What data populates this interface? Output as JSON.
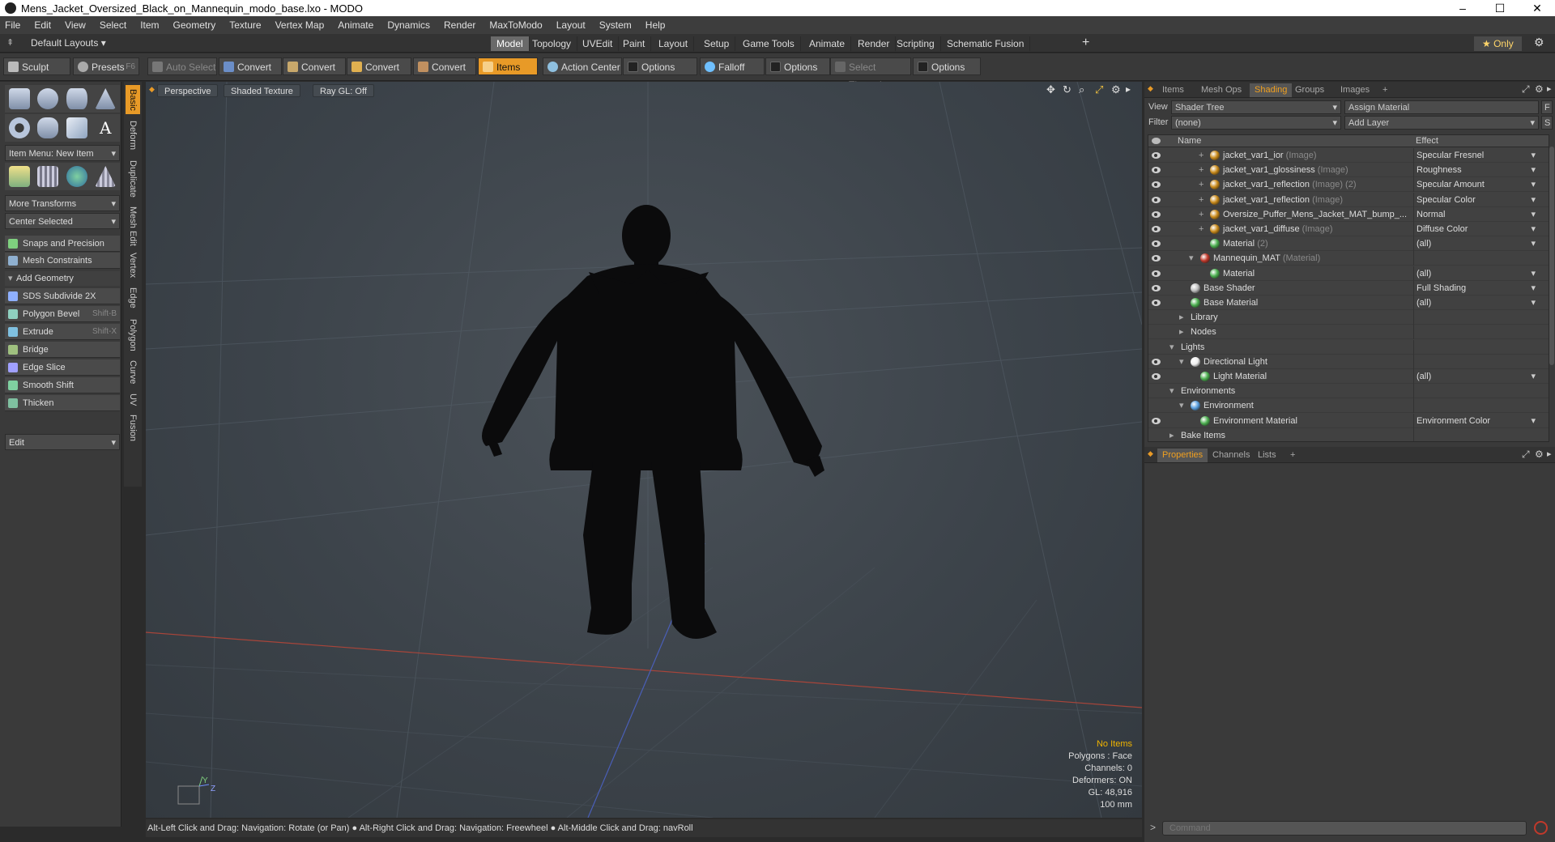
{
  "window": {
    "title": "Mens_Jacket_Oversized_Black_on_Mannequin_modo_base.lxo - MODO",
    "minimize": "–",
    "maximize": "☐",
    "close": "✕"
  },
  "menu": [
    "File",
    "Edit",
    "View",
    "Select",
    "Item",
    "Geometry",
    "Texture",
    "Vertex Map",
    "Animate",
    "Dynamics",
    "Render",
    "MaxToModo",
    "Layout",
    "System",
    "Help"
  ],
  "layout": {
    "preset": "Default Layouts ▾",
    "tabs": [
      "Model",
      "Topology",
      "UVEdit",
      "Paint",
      "Layout",
      "Setup",
      "Game Tools",
      "Animate",
      "Render",
      "Scripting",
      "Schematic Fusion"
    ],
    "active_tab": "Model",
    "add": "+",
    "only": "★  Only"
  },
  "toolbar": {
    "sculpt": "Sculpt",
    "presets": "Presets",
    "presets_key": "F6",
    "auto_select": "Auto Select",
    "convert1": "Convert",
    "convert2": "Convert",
    "convert3": "Convert",
    "convert4": "Convert",
    "items": "Items",
    "action_center": "Action Center",
    "options1": "Options",
    "falloff": "Falloff",
    "options2": "Options",
    "select_through": "Select Through",
    "options3": "Options"
  },
  "left": {
    "item_menu": "Item Menu: New Item",
    "more_transforms": "More Transforms",
    "center_selected": "Center Selected",
    "snaps": "Snaps and Precision",
    "mesh_constraints": "Mesh Constraints",
    "add_geometry": "Add Geometry",
    "tools": [
      {
        "label": "SDS Subdivide 2X",
        "key": ""
      },
      {
        "label": "Polygon Bevel",
        "key": "Shift-B"
      },
      {
        "label": "Extrude",
        "key": "Shift-X"
      },
      {
        "label": "Bridge",
        "key": ""
      },
      {
        "label": "Edge Slice",
        "key": ""
      },
      {
        "label": "Smooth Shift",
        "key": ""
      },
      {
        "label": "Thicken",
        "key": ""
      }
    ],
    "edit": "Edit",
    "vtabs": [
      "Basic",
      "Deform",
      "Duplicate",
      "Mesh Edit",
      "Vertex",
      "Edge",
      "Polygon",
      "Curve",
      "UV",
      "Fusion"
    ]
  },
  "viewport": {
    "perspective": "Perspective",
    "shading": "Shaded Texture",
    "raygl": "Ray GL: Off",
    "info": [
      "No Items",
      "Polygons : Face",
      "Channels: 0",
      "Deformers: ON",
      "GL: 48,916",
      "100 mm"
    ],
    "axis_y": "Y",
    "axis_z": "Z"
  },
  "status": "Alt-Left Click and Drag: Navigation: Rotate (or Pan) ● Alt-Right Click and Drag: Navigation: Freewheel ● Alt-Middle Click and Drag: navRoll",
  "shading": {
    "tabs": [
      "Items",
      "Mesh Ops",
      "Shading",
      "Groups",
      "Images",
      "+"
    ],
    "active_tab": "Shading",
    "view_label": "View",
    "view_value": "Shader Tree",
    "assign": "Assign Material",
    "f_btn": "F",
    "filter_label": "Filter",
    "filter_value": "(none)",
    "add_layer": "Add Layer",
    "s_btn": "S",
    "col_name": "Name",
    "col_effect": "Effect",
    "rows": [
      {
        "name": "jacket_var1_ior",
        "type": "(Image)",
        "effect": "Specular Fresnel",
        "indent": 3,
        "eye": true,
        "plus": true,
        "color": "#c98a1a",
        "drop": true
      },
      {
        "name": "jacket_var1_glossiness",
        "type": "(Image)",
        "effect": "Roughness",
        "indent": 3,
        "eye": true,
        "plus": true,
        "color": "#c98a1a",
        "drop": true
      },
      {
        "name": "jacket_var1_reflection",
        "type": "(Image) (2)",
        "effect": "Specular Amount",
        "indent": 3,
        "eye": true,
        "plus": true,
        "color": "#c98a1a",
        "drop": true
      },
      {
        "name": "jacket_var1_reflection",
        "type": "(Image)",
        "effect": "Specular Color",
        "indent": 3,
        "eye": true,
        "plus": true,
        "color": "#c98a1a",
        "drop": true
      },
      {
        "name": "Oversize_Puffer_Mens_Jacket_MAT_bump_...",
        "type": "",
        "effect": "Normal",
        "indent": 3,
        "eye": true,
        "plus": true,
        "color": "#c98a1a",
        "drop": true
      },
      {
        "name": "jacket_var1_diffuse",
        "type": "(Image)",
        "effect": "Diffuse Color",
        "indent": 3,
        "eye": true,
        "plus": true,
        "color": "#c98a1a",
        "drop": true
      },
      {
        "name": "Material",
        "type": "(2)",
        "effect": "(all)",
        "indent": 3,
        "eye": true,
        "plus": false,
        "color": "#4caf50",
        "drop": true
      },
      {
        "name": "Mannequin_MAT",
        "type": "(Material)",
        "effect": "",
        "indent": 2,
        "eye": true,
        "plus": false,
        "color": "#c0392b",
        "drop": false
      },
      {
        "name": "Material",
        "type": "",
        "effect": "(all)",
        "indent": 3,
        "eye": true,
        "plus": false,
        "color": "#4caf50",
        "drop": true
      },
      {
        "name": "Base Shader",
        "type": "",
        "effect": "Full Shading",
        "indent": 1,
        "eye": true,
        "plus": false,
        "color": "#bdbdbd",
        "drop": true
      },
      {
        "name": "Base Material",
        "type": "",
        "effect": "(all)",
        "indent": 1,
        "eye": true,
        "plus": false,
        "color": "#4caf50",
        "drop": true
      },
      {
        "name": "Library",
        "type": "",
        "effect": "",
        "indent": 1,
        "eye": false,
        "plus": false,
        "color": "",
        "drop": false
      },
      {
        "name": "Nodes",
        "type": "",
        "effect": "",
        "indent": 1,
        "eye": false,
        "plus": false,
        "color": "",
        "drop": false
      },
      {
        "name": "Lights",
        "type": "",
        "effect": "",
        "indent": 0,
        "eye": false,
        "plus": false,
        "color": "",
        "drop": false
      },
      {
        "name": "Directional Light",
        "type": "",
        "effect": "",
        "indent": 1,
        "eye": true,
        "plus": false,
        "color": "#eeeeee",
        "drop": false
      },
      {
        "name": "Light Material",
        "type": "",
        "effect": "(all)",
        "indent": 2,
        "eye": true,
        "plus": false,
        "color": "#4caf50",
        "drop": true
      },
      {
        "name": "Environments",
        "type": "",
        "effect": "",
        "indent": 0,
        "eye": false,
        "plus": false,
        "color": "",
        "drop": false
      },
      {
        "name": "Environment",
        "type": "",
        "effect": "",
        "indent": 1,
        "eye": false,
        "plus": false,
        "color": "#5aa0e0",
        "drop": false
      },
      {
        "name": "Environment Material",
        "type": "",
        "effect": "Environment Color",
        "indent": 2,
        "eye": true,
        "plus": false,
        "color": "#4caf50",
        "drop": true
      },
      {
        "name": "Bake Items",
        "type": "",
        "effect": "",
        "indent": 0,
        "eye": false,
        "plus": false,
        "color": "",
        "drop": false
      }
    ]
  },
  "properties": {
    "tabs": [
      "Properties",
      "Channels",
      "Lists",
      "+"
    ],
    "active_tab": "Properties"
  },
  "command": {
    "placeholder": "Command",
    "prompt": ">"
  },
  "colors": {
    "accent": "#e89a27",
    "info_highlight": "#f0b400"
  }
}
